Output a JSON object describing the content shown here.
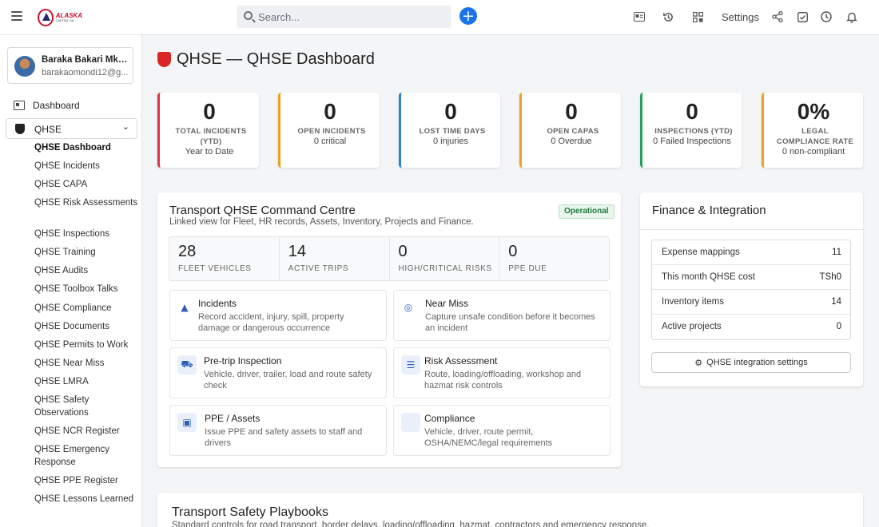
{
  "topbar": {
    "logo_line1": "ALASKA",
    "logo_line2": "CAPITAL SA",
    "search_placeholder": "Search...",
    "plus_label": "+",
    "settings_label": "Settings",
    "icons": [
      "menu-icon",
      "id-card-icon",
      "history-icon",
      "apps-icon",
      "share-icon",
      "check-square-icon",
      "clock-icon",
      "bell-icon"
    ]
  },
  "user": {
    "name": "Baraka Bakari Mkan...",
    "email": "barakaomondi12@g..."
  },
  "sidebar": {
    "dashboard_label": "Dashboard",
    "group_label": "QHSE",
    "items": [
      "QHSE Dashboard",
      "QHSE Incidents",
      "QHSE CAPA",
      "QHSE Risk Assessments",
      "QHSE Inspections",
      "QHSE Training",
      "QHSE Audits",
      "QHSE Toolbox Talks",
      "QHSE Compliance",
      "QHSE Documents",
      "QHSE Permits to Work",
      "QHSE Near Miss",
      "QHSE LMRA",
      "QHSE Safety Observations",
      "QHSE NCR Register",
      "QHSE Emergency Response",
      "QHSE PPE Register",
      "QHSE Lessons Learned"
    ]
  },
  "page": {
    "title": "QHSE — QHSE Dashboard"
  },
  "kpis": [
    {
      "value": "0",
      "label": "TOTAL INCIDENTS (YTD)",
      "sub": "Year to Date",
      "color": "#dc3545"
    },
    {
      "value": "0",
      "label": "OPEN INCIDENTS",
      "sub": "0 critical",
      "color": "#f0a020"
    },
    {
      "value": "0",
      "label": "LOST TIME DAYS",
      "sub": "0 injuries",
      "color": "#2f80d0"
    },
    {
      "value": "0",
      "label": "OPEN CAPAS",
      "sub": "0 Overdue",
      "color": "#f0a020"
    },
    {
      "value": "0",
      "label": "INSPECTIONS (YTD)",
      "sub": "0 Failed Inspections",
      "color": "#22a45a"
    },
    {
      "value": "0%",
      "label": "LEGAL COMPLIANCE RATE",
      "sub": "0 non-compliant",
      "color": "#f0a020"
    }
  ],
  "command_centre": {
    "title": "Transport QHSE Command Centre",
    "subtitle": "Linked view for Fleet, HR records, Assets, Inventory, Projects and Finance.",
    "badge": "Operational",
    "stats": [
      {
        "value": "28",
        "label": "FLEET VEHICLES"
      },
      {
        "value": "14",
        "label": "ACTIVE TRIPS"
      },
      {
        "value": "0",
        "label": "HIGH/CRITICAL RISKS"
      },
      {
        "value": "0",
        "label": "PPE DUE"
      }
    ],
    "tiles": [
      {
        "title": "Incidents",
        "desc": "Record accident, injury, spill, property damage or dangerous occurrence",
        "icon": "warning-icon",
        "glyph": "▲"
      },
      {
        "title": "Near Miss",
        "desc": "Capture unsafe condition before it becomes an incident",
        "icon": "target-icon",
        "glyph": "◎"
      },
      {
        "title": "Pre-trip Inspection",
        "desc": "Vehicle, driver, trailer, load and route safety check",
        "icon": "truck-icon",
        "glyph": "⛟"
      },
      {
        "title": "Risk Assessment",
        "desc": "Route, loading/offloading, workshop and hazmat risk controls",
        "icon": "list-icon",
        "glyph": "☰"
      },
      {
        "title": "PPE / Assets",
        "desc": "Issue PPE and safety assets to staff and drivers",
        "icon": "briefcase-icon",
        "glyph": "▣"
      },
      {
        "title": "Compliance",
        "desc": "Vehicle, driver, route permit, OSHA/NEMC/legal requirements",
        "icon": "compliance-icon",
        "glyph": ""
      }
    ]
  },
  "finance": {
    "title": "Finance & Integration",
    "rows": [
      {
        "label": "Expense mappings",
        "value": "11"
      },
      {
        "label": "This month QHSE cost",
        "value": "TSh0"
      },
      {
        "label": "Inventory items",
        "value": "14"
      },
      {
        "label": "Active projects",
        "value": "0"
      }
    ],
    "button_label": "QHSE integration settings"
  },
  "playbooks": {
    "title": "Transport Safety Playbooks",
    "subtitle": "Standard controls for road transport, border delays, loading/offloading, hazmat, contractors and emergency response."
  }
}
